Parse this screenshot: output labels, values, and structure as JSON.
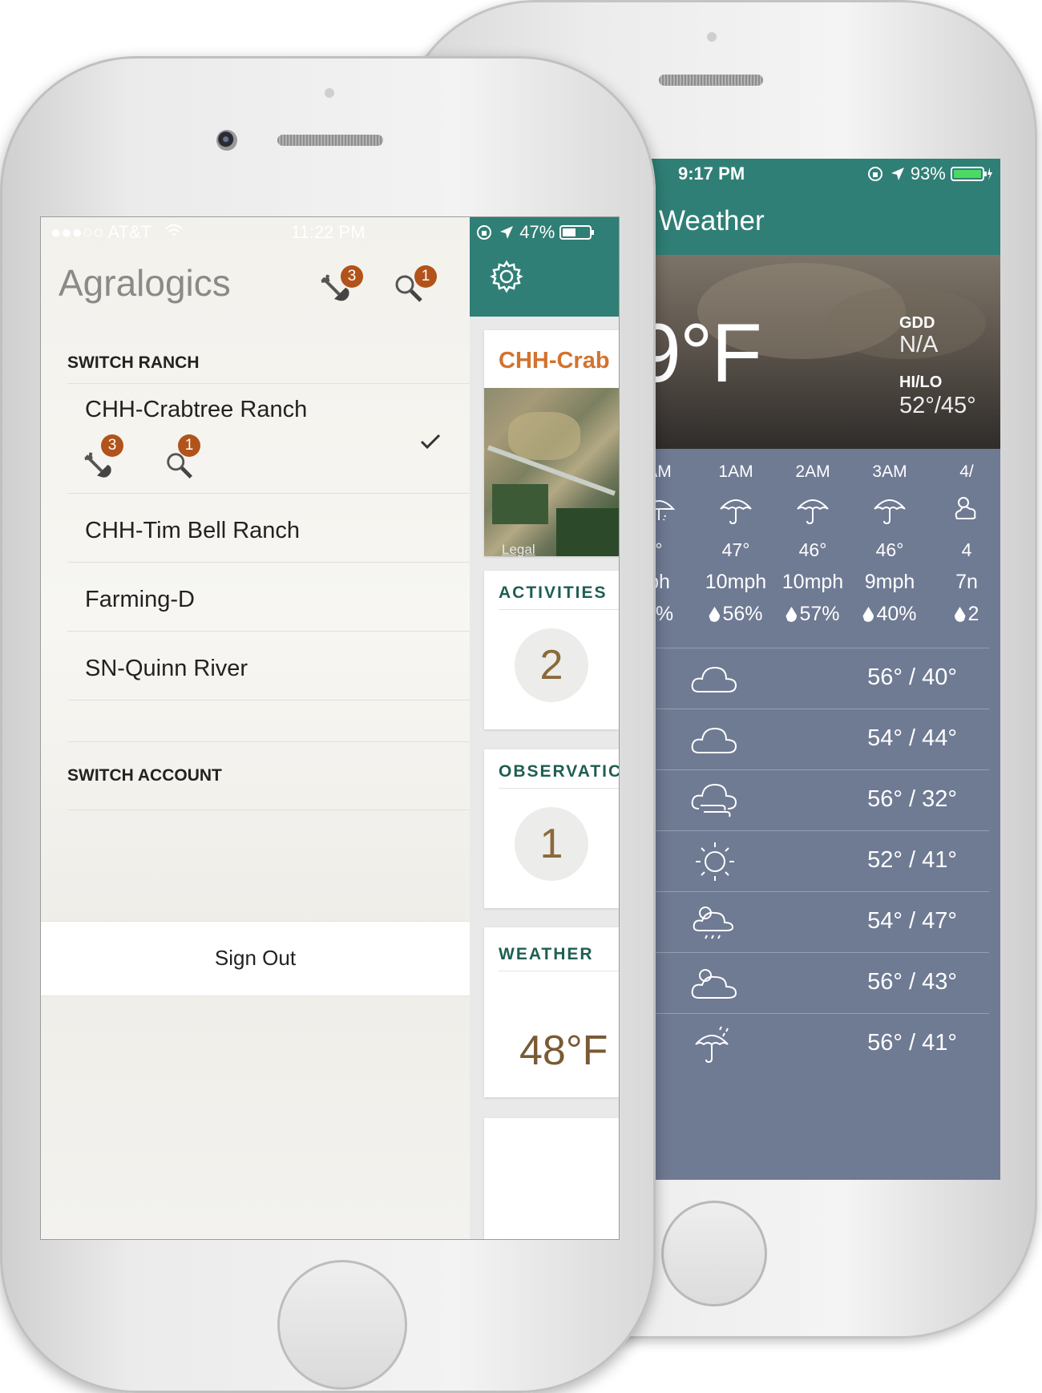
{
  "weather_screen": {
    "status": {
      "time": "9:17 PM",
      "battery": "93%"
    },
    "title": "Weather",
    "current_temp": "9°F",
    "gdd_label": "GDD",
    "gdd_value": "N/A",
    "hilo_label": "HI/LO",
    "hilo_value": "52°/45°",
    "hourly": [
      {
        "time": "AM",
        "icon": "umbrella-rain-icon",
        "temp": "°",
        "wind": "ph",
        "precip": "6%"
      },
      {
        "time": "1AM",
        "icon": "umbrella-icon",
        "temp": "47°",
        "wind": "10mph",
        "precip": "56%"
      },
      {
        "time": "2AM",
        "icon": "umbrella-icon",
        "temp": "46°",
        "wind": "10mph",
        "precip": "57%"
      },
      {
        "time": "3AM",
        "icon": "umbrella-icon",
        "temp": "46°",
        "wind": "9mph",
        "precip": "40%"
      },
      {
        "time": "4/",
        "icon": "sun-cloud-icon",
        "temp": "4",
        "wind": "7n",
        "precip": "2"
      }
    ],
    "daily": [
      {
        "icon": "cloud-icon",
        "range": "56° / 40°"
      },
      {
        "icon": "cloud-icon",
        "range": "54° / 44°"
      },
      {
        "icon": "wind-cloud-icon",
        "range": "56° / 32°"
      },
      {
        "icon": "sun-icon",
        "range": "52° / 41°"
      },
      {
        "icon": "sun-rain-cloud-icon",
        "range": "54° / 47°"
      },
      {
        "icon": "sun-cloud-icon",
        "range": "56° / 43°"
      },
      {
        "icon": "umbrella-rain-icon",
        "range": "56° / 41°"
      }
    ]
  },
  "drawer": {
    "status": {
      "carrier": "●●●○○ AT&T",
      "time": "11:22 PM"
    },
    "app_title": "Agralogics",
    "header_activities_badge": "3",
    "header_observations_badge": "1",
    "switch_ranch_label": "SWITCH RANCH",
    "ranches": [
      {
        "name": "CHH-Crabtree Ranch",
        "selected": true,
        "activities_badge": "3",
        "observations_badge": "1"
      },
      {
        "name": "CHH-Tim Bell Ranch"
      },
      {
        "name": "Farming-D"
      },
      {
        "name": "SN-Quinn River"
      }
    ],
    "switch_account_label": "SWITCH ACCOUNT",
    "sign_out": "Sign Out"
  },
  "dashboard": {
    "status": {
      "battery": "47%"
    },
    "ranch_card_title": "CHH-Crab",
    "map_legal": "Legal",
    "activities_title": "ACTIVITIES",
    "activities_count": "2",
    "observations_title": "OBSERVATIC",
    "observations_count": "1",
    "weather_title": "WEATHER",
    "weather_temp": "48°F"
  },
  "colors": {
    "teal": "#2f7f76",
    "badge": "#b1531a",
    "ranch_title": "#d2732e",
    "card_title": "#1f5e52"
  }
}
